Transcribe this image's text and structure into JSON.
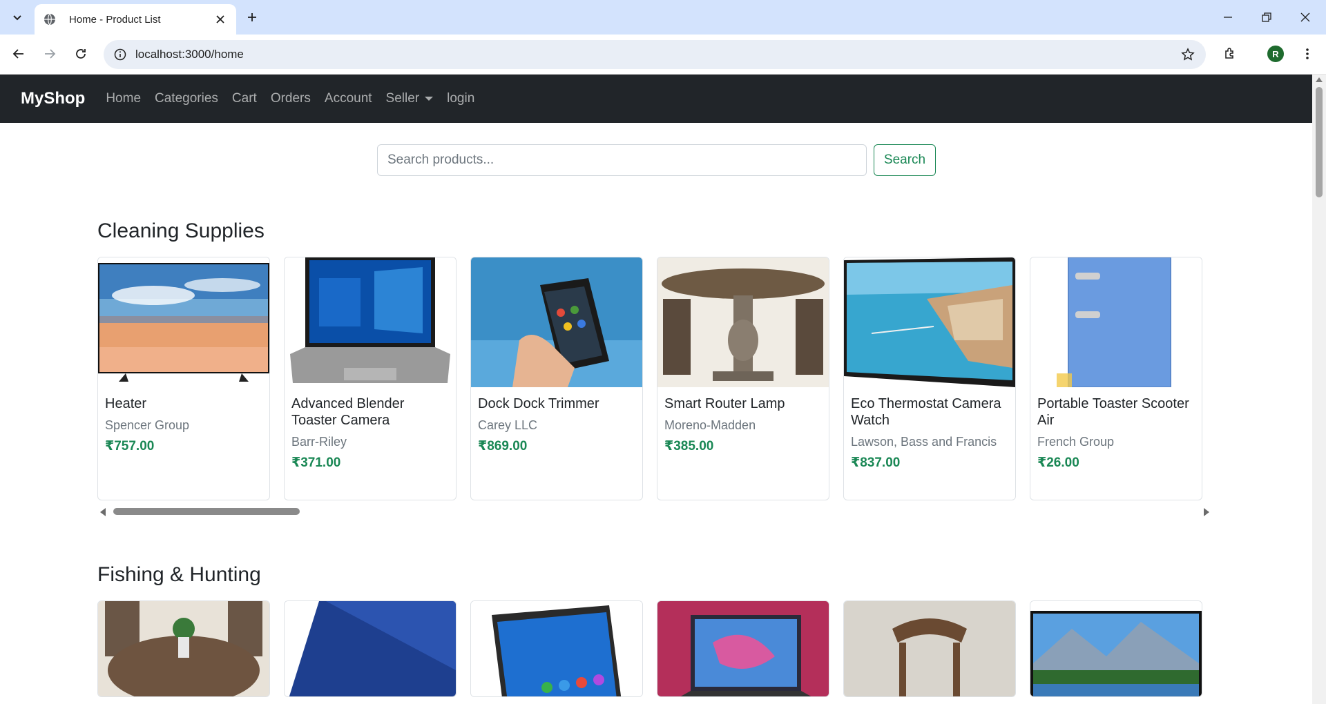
{
  "browser": {
    "tab_title": "Home - Product List",
    "url": "localhost:3000/home",
    "profile_initial": "R"
  },
  "navbar": {
    "brand": "MyShop",
    "links": [
      "Home",
      "Categories",
      "Cart",
      "Orders",
      "Account",
      "Seller",
      "login"
    ]
  },
  "search": {
    "placeholder": "Search products...",
    "button_label": "Search"
  },
  "sections": [
    {
      "title": "Cleaning Supplies",
      "products": [
        {
          "name": "Heater",
          "seller": "Spencer Group",
          "price": "₹757.00"
        },
        {
          "name": "Advanced Blender Toaster Camera",
          "seller": "Barr-Riley",
          "price": "₹371.00"
        },
        {
          "name": "Dock Dock Trimmer",
          "seller": "Carey LLC",
          "price": "₹869.00"
        },
        {
          "name": "Smart Router Lamp",
          "seller": "Moreno-Madden",
          "price": "₹385.00"
        },
        {
          "name": "Eco Thermostat Camera Watch",
          "seller": "Lawson, Bass and Francis",
          "price": "₹837.00"
        },
        {
          "name": "Portable Toaster Scooter Air",
          "seller": "French Group",
          "price": "₹26.00"
        }
      ]
    },
    {
      "title": "Fishing & Hunting",
      "products": []
    }
  ],
  "colors": {
    "navbar_bg": "#212529",
    "price_green": "#198754",
    "tabstrip_bg": "#d3e3fd"
  }
}
